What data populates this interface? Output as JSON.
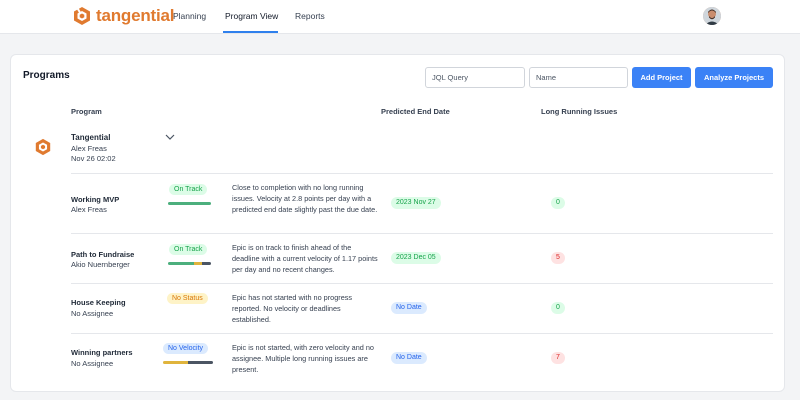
{
  "app": {
    "brand": "tangential",
    "brand_color": "#e07a2f",
    "accent_color": "#3b82f6",
    "nav": [
      {
        "label": "Planning"
      },
      {
        "label": "Program View",
        "active": true
      },
      {
        "label": "Reports"
      }
    ]
  },
  "programs": {
    "title": "Programs",
    "jql_placeholder": "JQL Query",
    "name_placeholder": "Name",
    "add_label": "Add Project",
    "analyze_label": "Analyze Projects",
    "columns": {
      "program": "Program",
      "predicted_end": "Predicted End Date",
      "long_running": "Long Running Issues"
    },
    "program": {
      "name": "Tangential",
      "owner": "Alex Freas",
      "date": "Nov 26 02:02"
    },
    "rows": [
      {
        "name": "Working MVP",
        "owner": "Alex Freas",
        "status": "On Track",
        "status_color": "green",
        "bar": [
          {
            "color": "#4caf7d",
            "fraction": 1.0
          }
        ],
        "description": "Close to completion with no long running issues. Velocity at 2.8 points per day with a predicted end date slightly past the due date.",
        "end_date": "2023 Nov 27",
        "end_date_color": "green",
        "long_running": "0",
        "long_running_color": "green"
      },
      {
        "name": "Path to Fundraise",
        "owner": "Akio Nuernberger",
        "status": "On Track",
        "status_color": "green",
        "bar": [
          {
            "color": "#4caf7d",
            "fraction": 0.6
          },
          {
            "color": "#e0b43c",
            "fraction": 0.2
          },
          {
            "color": "#4b5563",
            "fraction": 0.2
          }
        ],
        "description": "Epic is on track to finish ahead of the deadline with a current velocity of 1.17 points per day and no recent changes.",
        "end_date": "2023 Dec 05",
        "end_date_color": "green",
        "long_running": "5",
        "long_running_color": "red"
      },
      {
        "name": "House Keeping",
        "owner": "No Assignee",
        "status": "No Status",
        "status_color": "yellow",
        "bar": [],
        "description": "Epic has not started with no progress reported. No velocity or deadlines established.",
        "end_date": "No Date",
        "end_date_color": "blue",
        "long_running": "0",
        "long_running_color": "green"
      },
      {
        "name": "Winning partners",
        "owner": "No Assignee",
        "status": "No Velocity",
        "status_color": "blue",
        "bar": [
          {
            "color": "#e0b43c",
            "fraction": 0.5
          },
          {
            "color": "#4b5563",
            "fraction": 0.5
          }
        ],
        "description": "Epic is not started, with zero velocity and no assignee. Multiple long running issues are present.",
        "end_date": "No Date",
        "end_date_color": "blue",
        "long_running": "7",
        "long_running_color": "red"
      }
    ]
  }
}
